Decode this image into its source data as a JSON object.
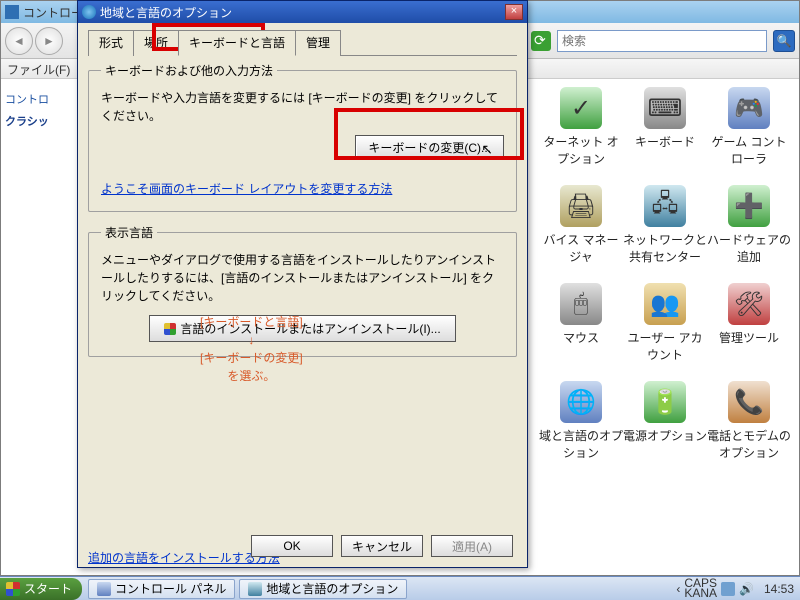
{
  "cp": {
    "title": "コントロー",
    "menu_file": "ファイル(F)",
    "search_placeholder": "検索",
    "side_link1": "コントロ",
    "side_link2": "クラシッ",
    "items": [
      {
        "label": "ターネット オプション"
      },
      {
        "label": "キーボード"
      },
      {
        "label": "ゲーム コントローラ"
      },
      {
        "label": "バイス マネージャ"
      },
      {
        "label": "ネットワークと共有センター"
      },
      {
        "label": "ハードウェアの追加"
      },
      {
        "label": "マウス"
      },
      {
        "label": "ユーザー アカウント"
      },
      {
        "label": "管理ツール"
      },
      {
        "label": "域と言語のオプション"
      },
      {
        "label": "電源オプション"
      },
      {
        "label": "電話とモデムのオプション"
      }
    ]
  },
  "dialog": {
    "title": "地域と言語のオプション",
    "close": "×",
    "tabs": {
      "format": "形式",
      "location": "場所",
      "keyboard": "キーボードと言語",
      "admin": "管理"
    },
    "fs1": {
      "legend": "キーボードおよび他の入力方法",
      "text": "キーボードや入力言語を変更するには [キーボードの変更] をクリックしてください。",
      "button": "キーボードの変更(C)...",
      "link": "ようこそ画面のキーボード レイアウトを変更する方法"
    },
    "fs2": {
      "legend": "表示言語",
      "text": "メニューやダイアログで使用する言語をインストールしたりアンインストールしたりするには、[言語のインストールまたはアンインストール] をクリックしてください。",
      "button": "言語のインストールまたはアンインストール(I)..."
    },
    "link_extra": "追加の言語をインストールする方法",
    "ok": "OK",
    "cancel": "キャンセル",
    "apply": "適用(A)"
  },
  "annotation": {
    "line1": "[キーボードと言語]",
    "arrow": "↓",
    "line2": "[キーボードの変更]",
    "line3": "を選ぶ。"
  },
  "taskbar": {
    "start": "スタート",
    "task1": "コントロール パネル",
    "task2": "地域と言語のオプション",
    "caps": "CAPS",
    "kana": "KANA",
    "clock": "14:53"
  }
}
